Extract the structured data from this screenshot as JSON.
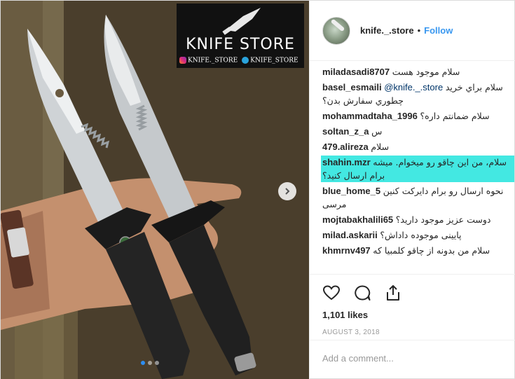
{
  "watermark": {
    "title": "KNIFE STORE",
    "insta_handle": "KNIFE._STORE",
    "telegram_handle": "KNIFE_STORE"
  },
  "header": {
    "username": "knife._.store",
    "separator": "•",
    "follow_label": "Follow"
  },
  "comments": [
    {
      "user": "miladasadi8707",
      "text": "سلام موجود هست",
      "highlight": false
    },
    {
      "user": "basel_esmaili",
      "mention": "@knife._.store",
      "text": "سلام براي خريد",
      "text2": "چطوري سفارش بدن؟",
      "highlight": false
    },
    {
      "user": "mohammadtaha_1996",
      "text": "سلام ضمانتم داره؟",
      "highlight": false
    },
    {
      "user": "soltan_z_a",
      "text": "س",
      "highlight": false
    },
    {
      "user": "479.alireza",
      "text": "سلام",
      "highlight": false
    },
    {
      "user": "shahin.mzr",
      "text": "سلام، من این چاقو رو میخوام. میشه",
      "text2": "برام ارسال کنید؟",
      "highlight": true
    },
    {
      "user": "blue_home_5",
      "text": "نحوه ارسال رو برام دایرکت کنین",
      "text2": "مرسی",
      "highlight": false
    },
    {
      "user": "mojtabakhalili65",
      "text": "دوست عزيز موجود داريد؟",
      "highlight": false
    },
    {
      "user": "milad.askarii",
      "text": "پايینی موجوده داداش؟",
      "highlight": false
    },
    {
      "user": "khmrnv497",
      "text": "سلام من بدونه از چاقو کلمبیا که",
      "highlight": false
    }
  ],
  "actions": {
    "likes": "1,101 likes",
    "date": "AUGUST 3, 2018",
    "add_comment_placeholder": "Add a comment..."
  },
  "icons": [
    "heart-icon",
    "comment-icon",
    "share-icon",
    "chevron-right-icon"
  ],
  "colors": {
    "follow": "#3897f0",
    "highlight": "#43e8e2",
    "carousel_active": "#2e8ef0"
  }
}
